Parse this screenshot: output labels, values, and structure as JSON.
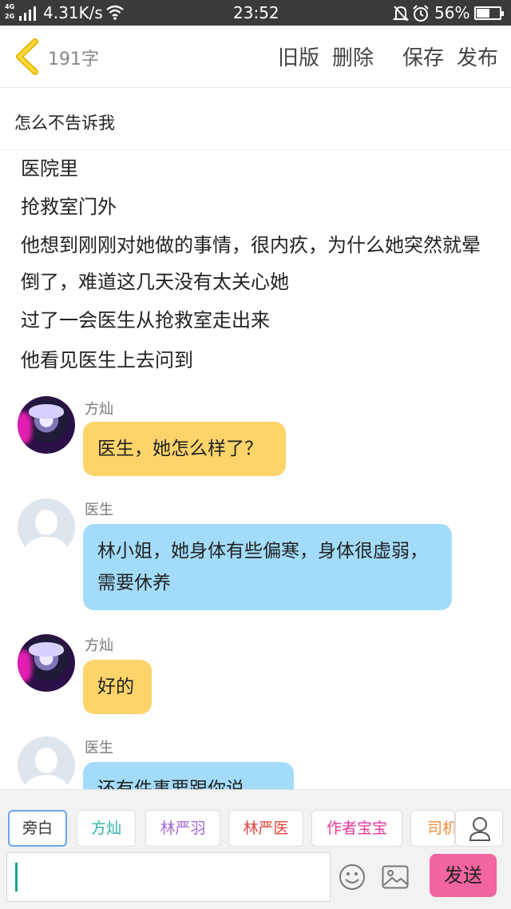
{
  "status_bar": {
    "network_top": "4G",
    "network_bottom": "2G",
    "speed": "4.31K/s",
    "time": "23:52",
    "battery_pct": "56%",
    "battery_level": 0.56
  },
  "header": {
    "word_count": "191字",
    "actions": [
      "旧版",
      "删除",
      "保存",
      "发布"
    ]
  },
  "title": "怎么不告诉我",
  "story": {
    "narration": [
      "医院里",
      "抢救室门外",
      "他想到刚刚对她做的事情，很内疚，为什么她突然就晕倒了，难道这几天没有太关心她",
      "过了一会医生从抢救室走出来",
      "他看见医生上去问到"
    ],
    "messages": [
      {
        "speaker": "方灿",
        "text": "医生，她怎么样了？",
        "bubble_color": "#fdd46a"
      },
      {
        "speaker": "医生",
        "text": "林小姐，她身体有些偏寒，身体很虚弱，需要休养",
        "bubble_color": "#a3dcfb"
      },
      {
        "speaker": "方灿",
        "text": "好的",
        "bubble_color": "#fdd46a"
      },
      {
        "speaker": "医生",
        "text": "还有件事要跟你说",
        "bubble_color": "#a3dcfb"
      }
    ]
  },
  "characters": [
    {
      "name": "旁白",
      "color": "#333333"
    },
    {
      "name": "方灿",
      "color": "#2bb3a8"
    },
    {
      "name": "林严羽",
      "color": "#a56ad6"
    },
    {
      "name": "林严医",
      "color": "#e0433d"
    },
    {
      "name": "作者宝宝",
      "color": "#e8369a"
    },
    {
      "name": "司机",
      "color": "#f08a3c"
    }
  ],
  "composer": {
    "input_value": "",
    "send_label": "发送",
    "send_color": "#f2659e"
  },
  "icons": [
    "back-arrow-icon",
    "wifi-icon",
    "bell-off-icon",
    "alarm-icon",
    "battery-icon",
    "person-icon",
    "emoji-icon",
    "image-icon"
  ]
}
